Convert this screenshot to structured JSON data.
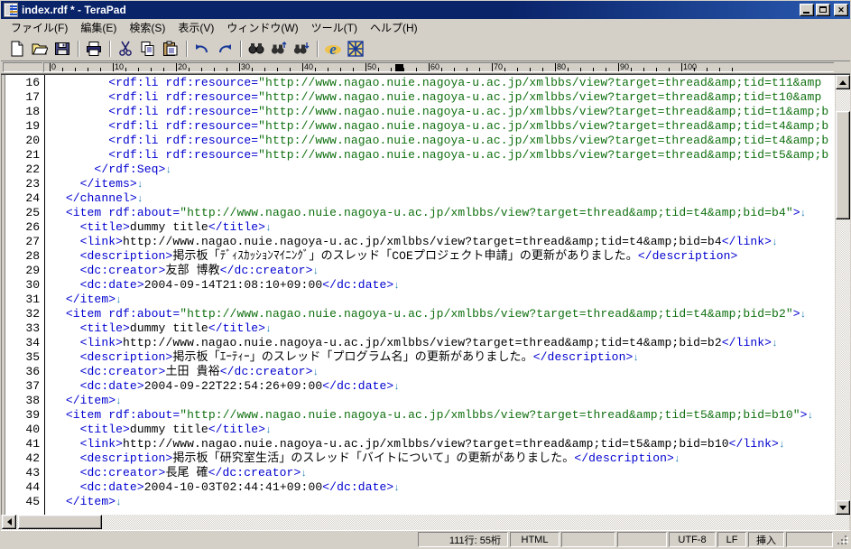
{
  "window": {
    "title": "index.rdf * - TeraPad",
    "icon": "document-icon",
    "minimize_label": "",
    "maximize_label": "",
    "close_label": "✕"
  },
  "menubar": {
    "items": [
      {
        "name": "file",
        "label": "ファイル(F)"
      },
      {
        "name": "edit",
        "label": "編集(E)"
      },
      {
        "name": "search",
        "label": "検索(S)"
      },
      {
        "name": "view",
        "label": "表示(V)"
      },
      {
        "name": "window",
        "label": "ウィンドウ(W)"
      },
      {
        "name": "tools",
        "label": "ツール(T)"
      },
      {
        "name": "help",
        "label": "ヘルプ(H)"
      }
    ]
  },
  "toolbar": {
    "buttons": [
      {
        "name": "new-file-icon",
        "title": "新規"
      },
      {
        "name": "open-file-icon",
        "title": "開く"
      },
      {
        "name": "save-file-icon",
        "title": "上書き保存"
      },
      {
        "name": "separator-1",
        "title": ""
      },
      {
        "name": "print-icon",
        "title": "印刷"
      },
      {
        "name": "separator-2",
        "title": ""
      },
      {
        "name": "cut-icon",
        "title": "切り取り"
      },
      {
        "name": "copy-icon",
        "title": "コピー"
      },
      {
        "name": "paste-icon",
        "title": "貼り付け"
      },
      {
        "name": "separator-3",
        "title": ""
      },
      {
        "name": "undo-icon",
        "title": "元に戻す"
      },
      {
        "name": "redo-icon",
        "title": "やり直し"
      },
      {
        "name": "separator-4",
        "title": ""
      },
      {
        "name": "find-icon",
        "title": "検索"
      },
      {
        "name": "find-previous-icon",
        "title": "前を検索"
      },
      {
        "name": "find-next-icon",
        "title": "次を検索"
      },
      {
        "name": "separator-5",
        "title": ""
      },
      {
        "name": "browser-preview-icon",
        "title": "ブラウザで表示"
      },
      {
        "name": "grid-tool-icon",
        "title": "ツール"
      }
    ]
  },
  "ruler": {
    "labels": [
      "0",
      "10",
      "20",
      "30",
      "40",
      "50",
      "60",
      "70",
      "80",
      "90",
      "100"
    ],
    "marker_column": 55,
    "char_width": 7
  },
  "editor": {
    "first_line_number": 16,
    "lines": [
      {
        "n": "16",
        "segs": [
          {
            "c": "txt",
            "t": "        "
          },
          {
            "c": "tag",
            "t": "<rdf:li rdf:resource="
          },
          {
            "c": "str",
            "t": "\"http://www.nagao.nuie.nagoya-u.ac.jp/xmlbbs/view?target=thread&amp;tid=t11&amp"
          }
        ]
      },
      {
        "n": "17",
        "segs": [
          {
            "c": "txt",
            "t": "        "
          },
          {
            "c": "tag",
            "t": "<rdf:li rdf:resource="
          },
          {
            "c": "str",
            "t": "\"http://www.nagao.nuie.nagoya-u.ac.jp/xmlbbs/view?target=thread&amp;tid=t10&amp"
          }
        ]
      },
      {
        "n": "18",
        "segs": [
          {
            "c": "txt",
            "t": "        "
          },
          {
            "c": "tag",
            "t": "<rdf:li rdf:resource="
          },
          {
            "c": "str",
            "t": "\"http://www.nagao.nuie.nagoya-u.ac.jp/xmlbbs/view?target=thread&amp;tid=t1&amp;b"
          }
        ]
      },
      {
        "n": "19",
        "segs": [
          {
            "c": "txt",
            "t": "        "
          },
          {
            "c": "tag",
            "t": "<rdf:li rdf:resource="
          },
          {
            "c": "str",
            "t": "\"http://www.nagao.nuie.nagoya-u.ac.jp/xmlbbs/view?target=thread&amp;tid=t4&amp;b"
          }
        ]
      },
      {
        "n": "20",
        "segs": [
          {
            "c": "txt",
            "t": "        "
          },
          {
            "c": "tag",
            "t": "<rdf:li rdf:resource="
          },
          {
            "c": "str",
            "t": "\"http://www.nagao.nuie.nagoya-u.ac.jp/xmlbbs/view?target=thread&amp;tid=t4&amp;b"
          }
        ]
      },
      {
        "n": "21",
        "segs": [
          {
            "c": "txt",
            "t": "        "
          },
          {
            "c": "tag",
            "t": "<rdf:li rdf:resource="
          },
          {
            "c": "str",
            "t": "\"http://www.nagao.nuie.nagoya-u.ac.jp/xmlbbs/view?target=thread&amp;tid=t5&amp;b"
          }
        ]
      },
      {
        "n": "22",
        "segs": [
          {
            "c": "txt",
            "t": "      "
          },
          {
            "c": "tag",
            "t": "</rdf:Seq>"
          },
          {
            "c": "cr",
            "t": "↓"
          }
        ]
      },
      {
        "n": "23",
        "segs": [
          {
            "c": "txt",
            "t": "    "
          },
          {
            "c": "tag",
            "t": "</items>"
          },
          {
            "c": "cr",
            "t": "↓"
          }
        ]
      },
      {
        "n": "24",
        "segs": [
          {
            "c": "txt",
            "t": "  "
          },
          {
            "c": "tag",
            "t": "</channel>"
          },
          {
            "c": "cr",
            "t": "↓"
          }
        ]
      },
      {
        "n": "25",
        "segs": [
          {
            "c": "txt",
            "t": "  "
          },
          {
            "c": "tag",
            "t": "<item rdf:about="
          },
          {
            "c": "str",
            "t": "\"http://www.nagao.nuie.nagoya-u.ac.jp/xmlbbs/view?target=thread&amp;tid=t4&amp;bid=b4\""
          },
          {
            "c": "tag",
            "t": ">"
          },
          {
            "c": "cr",
            "t": "↓"
          }
        ]
      },
      {
        "n": "26",
        "segs": [
          {
            "c": "txt",
            "t": "    "
          },
          {
            "c": "tag",
            "t": "<title>"
          },
          {
            "c": "txt",
            "t": "dummy title"
          },
          {
            "c": "tag",
            "t": "</title>"
          },
          {
            "c": "cr",
            "t": "↓"
          }
        ]
      },
      {
        "n": "27",
        "segs": [
          {
            "c": "txt",
            "t": "    "
          },
          {
            "c": "tag",
            "t": "<link>"
          },
          {
            "c": "txt",
            "t": "http://www.nagao.nuie.nagoya-u.ac.jp/xmlbbs/view?target=thread&amp;tid=t4&amp;bid=b4"
          },
          {
            "c": "tag",
            "t": "</link>"
          },
          {
            "c": "cr",
            "t": "↓"
          }
        ]
      },
      {
        "n": "28",
        "segs": [
          {
            "c": "txt",
            "t": "    "
          },
          {
            "c": "tag",
            "t": "<description>"
          },
          {
            "c": "txt",
            "t": "掲示板「ﾃﾞｨｽｶｯｼｮﾝﾏｲﾆﾝｸﾞ」のスレッド「COEプロジェクト申請」の更新がありました。"
          },
          {
            "c": "tag",
            "t": "</description>"
          }
        ]
      },
      {
        "n": "29",
        "segs": [
          {
            "c": "txt",
            "t": "    "
          },
          {
            "c": "tag",
            "t": "<dc:creator>"
          },
          {
            "c": "txt",
            "t": "友部 博教"
          },
          {
            "c": "tag",
            "t": "</dc:creator>"
          },
          {
            "c": "cr",
            "t": "↓"
          }
        ]
      },
      {
        "n": "30",
        "segs": [
          {
            "c": "txt",
            "t": "    "
          },
          {
            "c": "tag",
            "t": "<dc:date>"
          },
          {
            "c": "txt",
            "t": "2004-09-14T21:08:10+09:00"
          },
          {
            "c": "tag",
            "t": "</dc:date>"
          },
          {
            "c": "cr",
            "t": "↓"
          }
        ]
      },
      {
        "n": "31",
        "segs": [
          {
            "c": "txt",
            "t": "  "
          },
          {
            "c": "tag",
            "t": "</item>"
          },
          {
            "c": "cr",
            "t": "↓"
          }
        ]
      },
      {
        "n": "32",
        "segs": [
          {
            "c": "txt",
            "t": "  "
          },
          {
            "c": "tag",
            "t": "<item rdf:about="
          },
          {
            "c": "str",
            "t": "\"http://www.nagao.nuie.nagoya-u.ac.jp/xmlbbs/view?target=thread&amp;tid=t4&amp;bid=b2\""
          },
          {
            "c": "tag",
            "t": ">"
          },
          {
            "c": "cr",
            "t": "↓"
          }
        ]
      },
      {
        "n": "33",
        "segs": [
          {
            "c": "txt",
            "t": "    "
          },
          {
            "c": "tag",
            "t": "<title>"
          },
          {
            "c": "txt",
            "t": "dummy title"
          },
          {
            "c": "tag",
            "t": "</title>"
          },
          {
            "c": "cr",
            "t": "↓"
          }
        ]
      },
      {
        "n": "34",
        "segs": [
          {
            "c": "txt",
            "t": "    "
          },
          {
            "c": "tag",
            "t": "<link>"
          },
          {
            "c": "txt",
            "t": "http://www.nagao.nuie.nagoya-u.ac.jp/xmlbbs/view?target=thread&amp;tid=t4&amp;bid=b2"
          },
          {
            "c": "tag",
            "t": "</link>"
          },
          {
            "c": "cr",
            "t": "↓"
          }
        ]
      },
      {
        "n": "35",
        "segs": [
          {
            "c": "txt",
            "t": "    "
          },
          {
            "c": "tag",
            "t": "<description>"
          },
          {
            "c": "txt",
            "t": "掲示板「ｴｰﾃｨｰ」のスレッド「プログラム名」の更新がありました。"
          },
          {
            "c": "tag",
            "t": "</description>"
          },
          {
            "c": "cr",
            "t": "↓"
          }
        ]
      },
      {
        "n": "36",
        "segs": [
          {
            "c": "txt",
            "t": "    "
          },
          {
            "c": "tag",
            "t": "<dc:creator>"
          },
          {
            "c": "txt",
            "t": "土田 貴裕"
          },
          {
            "c": "tag",
            "t": "</dc:creator>"
          },
          {
            "c": "cr",
            "t": "↓"
          }
        ]
      },
      {
        "n": "37",
        "segs": [
          {
            "c": "txt",
            "t": "    "
          },
          {
            "c": "tag",
            "t": "<dc:date>"
          },
          {
            "c": "txt",
            "t": "2004-09-22T22:54:26+09:00"
          },
          {
            "c": "tag",
            "t": "</dc:date>"
          },
          {
            "c": "cr",
            "t": "↓"
          }
        ]
      },
      {
        "n": "38",
        "segs": [
          {
            "c": "txt",
            "t": "  "
          },
          {
            "c": "tag",
            "t": "</item>"
          },
          {
            "c": "cr",
            "t": "↓"
          }
        ]
      },
      {
        "n": "39",
        "segs": [
          {
            "c": "txt",
            "t": "  "
          },
          {
            "c": "tag",
            "t": "<item rdf:about="
          },
          {
            "c": "str",
            "t": "\"http://www.nagao.nuie.nagoya-u.ac.jp/xmlbbs/view?target=thread&amp;tid=t5&amp;bid=b10\""
          },
          {
            "c": "tag",
            "t": ">"
          },
          {
            "c": "cr",
            "t": "↓"
          }
        ]
      },
      {
        "n": "40",
        "segs": [
          {
            "c": "txt",
            "t": "    "
          },
          {
            "c": "tag",
            "t": "<title>"
          },
          {
            "c": "txt",
            "t": "dummy title"
          },
          {
            "c": "tag",
            "t": "</title>"
          },
          {
            "c": "cr",
            "t": "↓"
          }
        ]
      },
      {
        "n": "41",
        "segs": [
          {
            "c": "txt",
            "t": "    "
          },
          {
            "c": "tag",
            "t": "<link>"
          },
          {
            "c": "txt",
            "t": "http://www.nagao.nuie.nagoya-u.ac.jp/xmlbbs/view?target=thread&amp;tid=t5&amp;bid=b10"
          },
          {
            "c": "tag",
            "t": "</link>"
          },
          {
            "c": "cr",
            "t": "↓"
          }
        ]
      },
      {
        "n": "42",
        "segs": [
          {
            "c": "txt",
            "t": "    "
          },
          {
            "c": "tag",
            "t": "<description>"
          },
          {
            "c": "txt",
            "t": "掲示板「研究室生活」のスレッド「バイトについて」の更新がありました。"
          },
          {
            "c": "tag",
            "t": "</description>"
          },
          {
            "c": "cr",
            "t": "↓"
          }
        ]
      },
      {
        "n": "43",
        "segs": [
          {
            "c": "txt",
            "t": "    "
          },
          {
            "c": "tag",
            "t": "<dc:creator>"
          },
          {
            "c": "txt",
            "t": "長尾 確"
          },
          {
            "c": "tag",
            "t": "</dc:creator>"
          },
          {
            "c": "cr",
            "t": "↓"
          }
        ]
      },
      {
        "n": "44",
        "segs": [
          {
            "c": "txt",
            "t": "    "
          },
          {
            "c": "tag",
            "t": "<dc:date>"
          },
          {
            "c": "txt",
            "t": "2004-10-03T02:44:41+09:00"
          },
          {
            "c": "tag",
            "t": "</dc:date>"
          },
          {
            "c": "cr",
            "t": "↓"
          }
        ]
      },
      {
        "n": "45",
        "segs": [
          {
            "c": "txt",
            "t": "  "
          },
          {
            "c": "tag",
            "t": "</item>"
          },
          {
            "c": "cr",
            "t": "↓"
          }
        ]
      }
    ],
    "colors": {
      "tag": "#0000d0",
      "string": "#107010",
      "text": "#000000",
      "eol_mark": "#1a7ab0",
      "background": "#ffffff"
    }
  },
  "statusbar": {
    "position": "111行: 55桁",
    "filetype": "HTML",
    "blank1": "",
    "blank2": "",
    "encoding": "UTF-8",
    "eol": "LF",
    "insert_mode": "挿入",
    "blank3": ""
  }
}
